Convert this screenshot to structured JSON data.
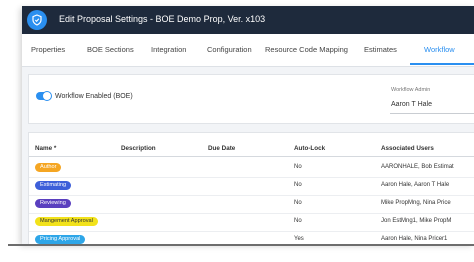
{
  "window": {
    "title": "Edit Proposal Settings - BOE Demo Prop, Ver. x103"
  },
  "tabs": [
    {
      "label": "Properties"
    },
    {
      "label": "BOE Sections"
    },
    {
      "label": "Integration"
    },
    {
      "label": "Configuration"
    },
    {
      "label": "Resource Code Mapping"
    },
    {
      "label": "Estimates"
    },
    {
      "label": "Workflow"
    }
  ],
  "active_tab": "Workflow",
  "workflow": {
    "enabled_label": "Workflow Enabled (BOE)",
    "enabled": true,
    "admin_label": "Workflow Admin",
    "admin_value": "Aaron T Hale"
  },
  "table": {
    "columns": [
      "Name *",
      "Description",
      "Due Date",
      "Auto-Lock",
      "Associated Users"
    ],
    "rows": [
      {
        "name": "Author",
        "description": "",
        "due_date": "",
        "auto_lock": "No",
        "users": "AARONHALE, Bob Estimat",
        "pill_color": "#f5a623",
        "pill_text_color": "#ffffff"
      },
      {
        "name": "Estimating",
        "description": "",
        "due_date": "",
        "auto_lock": "No",
        "users": "Aaron Hale, Aaron T Hale",
        "pill_color": "#3d5fd9",
        "pill_text_color": "#ffffff"
      },
      {
        "name": "Reviewing",
        "description": "",
        "due_date": "",
        "auto_lock": "No",
        "users": "Mike PropMng, Nina Price",
        "pill_color": "#5a3fbf",
        "pill_text_color": "#ffffff"
      },
      {
        "name": "Mangement Approval",
        "description": "",
        "due_date": "",
        "auto_lock": "No",
        "users": "Jon EstMng1, Mike PropM",
        "pill_color": "#f2e21b",
        "pill_text_color": "#333333"
      },
      {
        "name": "Pricing Approval",
        "description": "",
        "due_date": "",
        "auto_lock": "Yes",
        "users": "Aaron Hale, Nina Pricer1",
        "pill_color": "#2ea6e8",
        "pill_text_color": "#ffffff"
      }
    ]
  },
  "colors": {
    "titlebar": "#1e2a3c",
    "accent": "#2a8ff0"
  },
  "icons": {
    "app_logo": "shield-logo-icon"
  }
}
